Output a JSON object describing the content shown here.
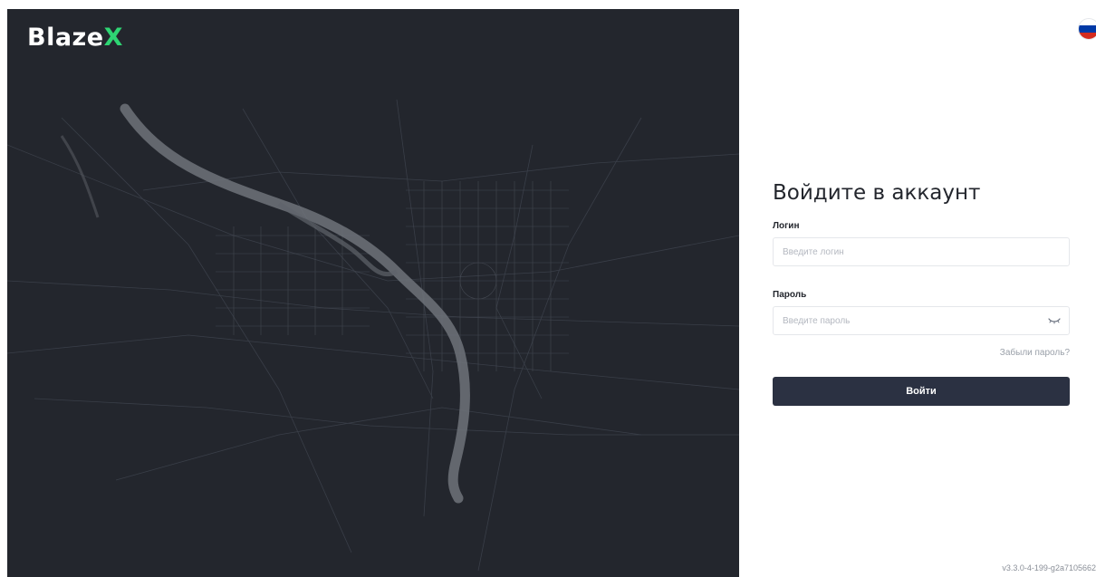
{
  "brand": {
    "logo_main": "Blaze",
    "logo_accent": "X",
    "accent_color": "#2ed573",
    "map_background": "#23262d"
  },
  "language": {
    "selected": "ru",
    "flag_colors": [
      "#ffffff",
      "#0039a6",
      "#d52b1e"
    ]
  },
  "login_form": {
    "title": "Войдите в аккаунт",
    "login_label": "Логин",
    "login_placeholder": "Введите логин",
    "login_value": "",
    "password_label": "Пароль",
    "password_placeholder": "Введите пароль",
    "password_value": "",
    "forgot_link": "Забыли пароль?",
    "submit_label": "Войти",
    "submit_color": "#2b3142"
  },
  "footer": {
    "version": "v3.3.0-4-199-g2a7105662"
  }
}
